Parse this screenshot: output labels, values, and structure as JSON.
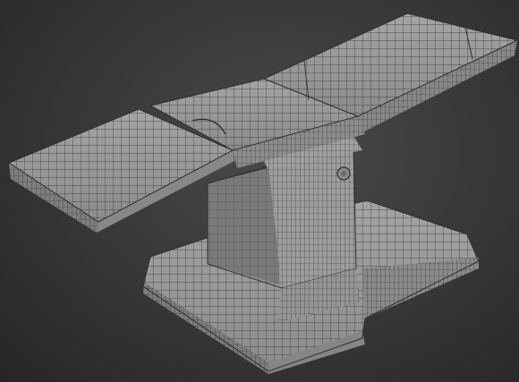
{
  "scene": {
    "background_color": "#3b3b3b",
    "model_face_color": "#9a9a9a",
    "model_dark_face_color": "#6e6e6e",
    "wire_color": "#2e2e2e",
    "subject": "surgical-table-wireframe-model"
  }
}
